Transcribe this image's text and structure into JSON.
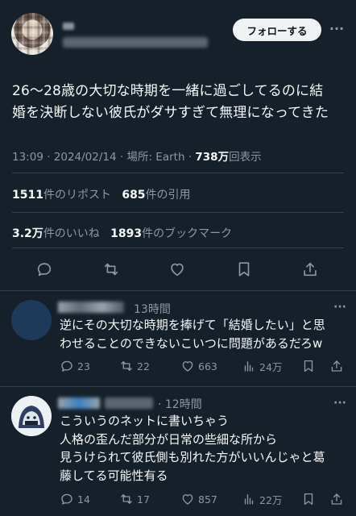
{
  "tweet": {
    "follow_label": "フォローする",
    "more_label": "···",
    "text_line1": "26〜28歳の大切な時期を一緒に過ごしてるのに結",
    "text_line2": "婚を決断しない彼氏がダサすぎて無理になってきた",
    "meta_time": "13:09 · 2024/02/14 · 場所: Earth · ",
    "meta_views": "738万",
    "meta_views_suffix": "回表示",
    "reposts_count": "1511",
    "reposts_label": "件のリポスト",
    "quotes_count": "685",
    "quotes_label": "件の引用",
    "likes_count": "3.2万",
    "likes_label": "件のいいね",
    "bookmarks_count": "1893",
    "bookmarks_label": "件のブックマーク"
  },
  "replies": [
    {
      "time": "13時間",
      "text_line1": "逆にその大切な時期を捧げて「結婚したい」と思",
      "text_line2": "わせることのできないこいつに問題があるだろw",
      "replies": "23",
      "reposts": "22",
      "likes": "663",
      "views": "24万"
    },
    {
      "time": "· 12時間",
      "text_line1": "こういうのネットに書いちゃう",
      "text_line2": "人格の歪んだ部分が日常の些細な所から",
      "text_line3": "見うけられて彼氏側も別れた方がいいんじゃと葛",
      "text_line4": "藤してる可能性有る",
      "replies": "14",
      "reposts": "17",
      "likes": "857",
      "views": "22万"
    }
  ],
  "colors": {
    "background": "#15202b",
    "text": "#f7f9f9",
    "secondary": "#8b98a5",
    "divider": "#38444d",
    "button_bg": "#eff3f4"
  },
  "icons": [
    "reply-icon",
    "repost-icon",
    "like-icon",
    "bookmark-icon",
    "share-icon",
    "views-icon",
    "more-icon"
  ]
}
